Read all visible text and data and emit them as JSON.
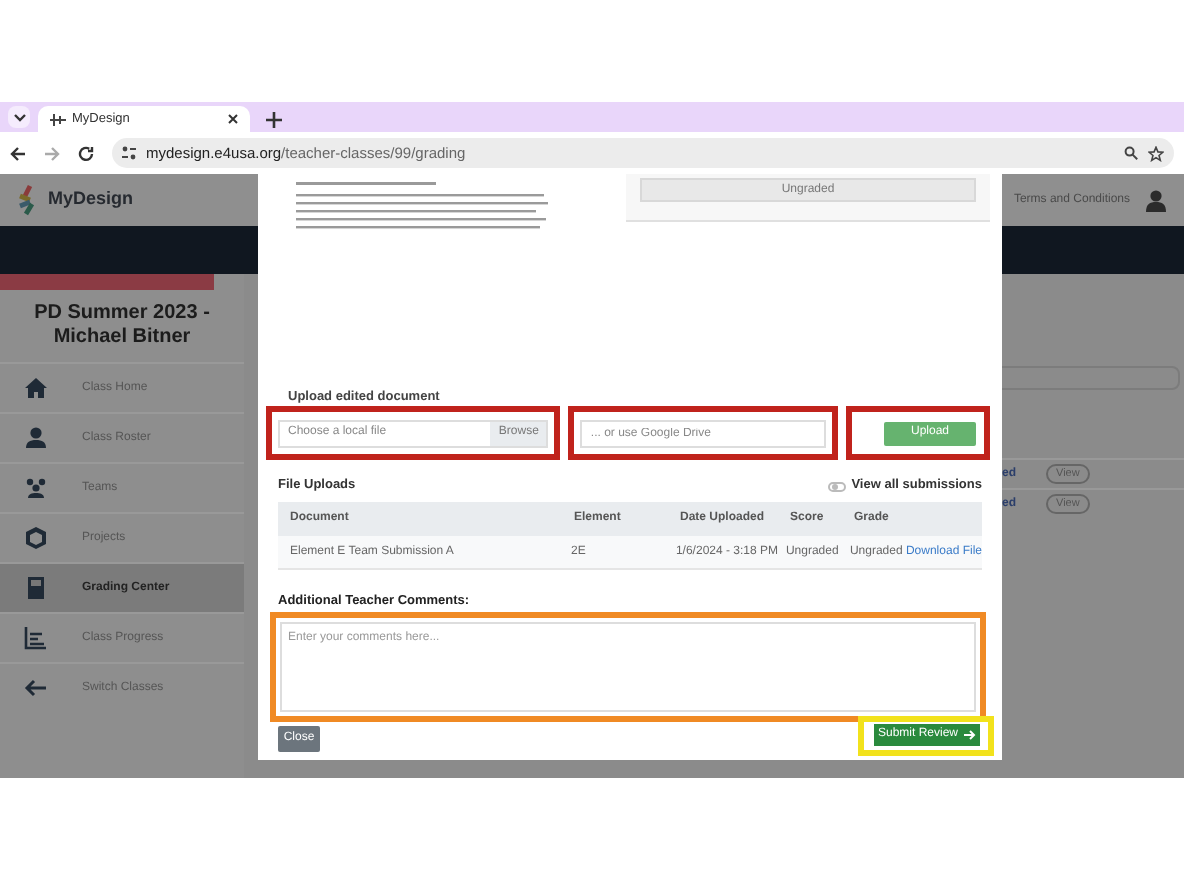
{
  "browser": {
    "tabs": [
      {
        "title": "MyDesign",
        "selected": true
      }
    ],
    "url": {
      "host": "mydesign.e4usa.org",
      "path": "/teacher-classes/99/grading"
    }
  },
  "header": {
    "logo": "MyDesign",
    "terms_link": "Terms and Conditions"
  },
  "sidebar": {
    "title": "PD Summer 2023 - Michael Bitner",
    "items": [
      {
        "label": "Class Home",
        "selected": false
      },
      {
        "label": "Class Roster",
        "selected": false
      },
      {
        "label": "Teams",
        "selected": false
      },
      {
        "label": "Projects",
        "selected": false
      },
      {
        "label": "Grading Center",
        "selected": true
      },
      {
        "label": "Class Progress",
        "selected": false
      },
      {
        "label": "Switch Classes",
        "selected": false
      }
    ]
  },
  "background_table": {
    "rows": [
      {
        "column_1": "ed",
        "action": "View"
      },
      {
        "column_1": "ed",
        "action": "View"
      }
    ]
  },
  "modal": {
    "grade_panel": {
      "status": "Ungraded"
    },
    "upload": {
      "label": "Upload edited document",
      "file_field": {
        "placeholder": "Choose a local file",
        "button": "Browse"
      },
      "drive_field": {
        "placeholder": "... or use Google Drive"
      },
      "upload_button": "Upload"
    },
    "file_uploads": {
      "title": "File Uploads",
      "view_all": {
        "label": "View all submissions",
        "on": false
      },
      "columns": [
        "Document",
        "Element",
        "Date Uploaded",
        "Score",
        "Grade"
      ],
      "rows": [
        {
          "document": "Element E Team Submission A",
          "element": "2E",
          "date_uploaded": "1/6/2024 - 3:18 PM",
          "score": "Ungraded",
          "grade": "Ungraded",
          "link": "Download File"
        }
      ]
    },
    "comments": {
      "label": "Additional Teacher Comments:",
      "placeholder": "Enter your comments here..."
    },
    "close_button": "Close",
    "submit_button": "Submit Review"
  }
}
